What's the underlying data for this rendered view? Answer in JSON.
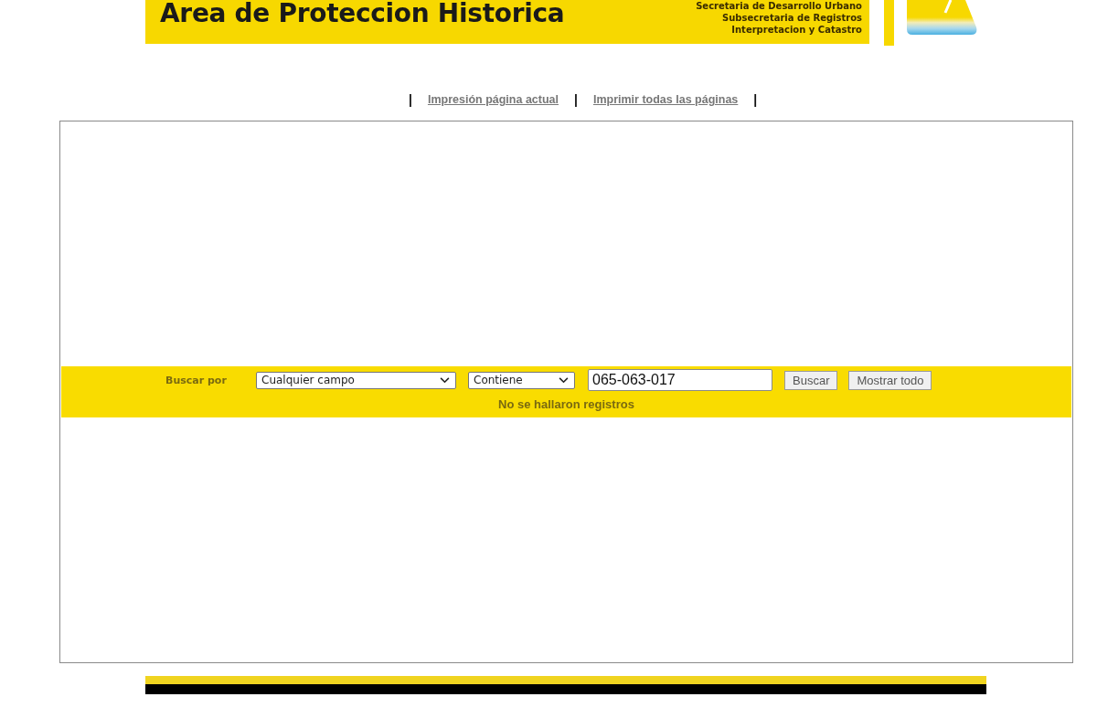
{
  "header": {
    "title": "Area de Proteccion Historica",
    "agency_lines": [
      "Secretaria de Desarrollo Urbano",
      "Subsecretaria de Registros",
      "Interpretacion y Catastro"
    ]
  },
  "print_bar": [
    {
      "kind": "separator",
      "text": "|"
    },
    {
      "kind": "link",
      "text": "Impresión página actual"
    },
    {
      "kind": "separator",
      "text": "|"
    },
    {
      "kind": "link",
      "text": "Imprimir todas las páginas"
    },
    {
      "kind": "separator",
      "text": "|"
    }
  ],
  "search": {
    "label": "Buscar por",
    "field_select": "Cualquier campo",
    "operator_select": "Contiene",
    "query": {
      "value": "065-063-017"
    },
    "buttons": [
      "Buscar",
      "Mostrar todo"
    ],
    "message": "No se hallaron registros"
  }
}
